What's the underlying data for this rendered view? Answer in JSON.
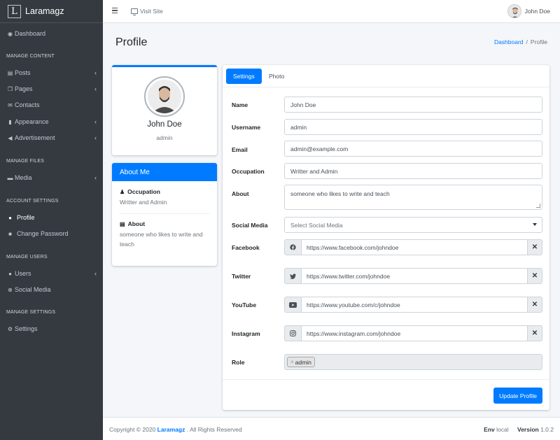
{
  "brand": {
    "logo_letter": "L",
    "name": "Laramagz"
  },
  "sidebar": {
    "dashboard": "Dashboard",
    "sections": {
      "manage_content": "MANAGE CONTENT",
      "manage_files": "MANAGE FILES",
      "account_settings": "ACCOUNT SETTINGS",
      "manage_users": "MANAGE USERS",
      "manage_settings": "MANAGE SETTINGS"
    },
    "items": {
      "posts": "Posts",
      "pages": "Pages",
      "contacts": "Contacts",
      "appearance": "Appearance",
      "advertisement": "Advertisement",
      "media": "Media",
      "profile": "Profile",
      "change_password": "Change Password",
      "users": "Users",
      "social_media": "Social Media",
      "settings": "Settings"
    },
    "active_item": "Profile"
  },
  "topnav": {
    "visit_site": "Visit Site",
    "user_name": "John Doe"
  },
  "header": {
    "title": "Profile",
    "breadcrumb": {
      "home": "Dashboard",
      "separator": "/",
      "current": "Profile"
    }
  },
  "profile_card": {
    "name": "John Doe",
    "role": "admin"
  },
  "about": {
    "title": "About Me",
    "occupation_label": "Occupation",
    "occupation_value": "Writter and Admin",
    "about_label": "About",
    "about_value": "someone who likes to write and teach"
  },
  "tabs": {
    "settings": "Settings",
    "photo": "Photo",
    "active": "Settings"
  },
  "form": {
    "name": {
      "label": "Name",
      "value": "John Doe"
    },
    "username": {
      "label": "Username",
      "value": "admin"
    },
    "email": {
      "label": "Email",
      "value": "admin@example.com"
    },
    "occupation": {
      "label": "Occupation",
      "value": "Writter and Admin"
    },
    "about": {
      "label": "About",
      "value": "someone who likes to write and teach"
    },
    "social_media": {
      "label": "Social Media",
      "placeholder": "Select Social Media"
    },
    "facebook": {
      "label": "Facebook",
      "value": "https://www.facebook.com/johndoe",
      "icon": "facebook-icon"
    },
    "twitter": {
      "label": "Twitter",
      "value": "https://www.twitter.com/johndoe",
      "icon": "twitter-icon"
    },
    "youtube": {
      "label": "YouTube",
      "value": "https://www.youtube.com/c/johndoe",
      "icon": "youtube-icon"
    },
    "instagram": {
      "label": "Instagram",
      "value": "https://www.instagram.com/johndoe",
      "icon": "instagram-icon"
    },
    "clear_symbol": "✕",
    "role": {
      "label": "Role",
      "chip": "admin",
      "chip_remove": "×"
    },
    "submit": "Update Profile"
  },
  "footer": {
    "copyright_prefix": "Copyright © 2020",
    "brand": "Laramagz",
    "suffix": ". All Rights Reserved",
    "env_label": "Env",
    "env_value": "local",
    "version_label": "Version",
    "version_value": "1.0.2"
  },
  "colors": {
    "primary": "#007bff",
    "sidebar": "#343a40",
    "background": "#f4f6f9"
  }
}
